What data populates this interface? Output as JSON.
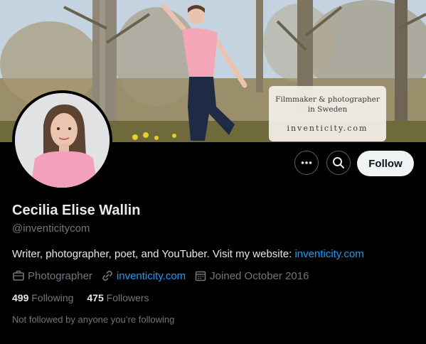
{
  "banner": {
    "card_line1": "Filmmaker & photographer",
    "card_line2": "in Sweden",
    "card_line3": "inventicity.com"
  },
  "actions": {
    "more_icon": "more-dots-icon",
    "search_icon": "search-icon",
    "follow_label": "Follow"
  },
  "profile": {
    "name": "Cecilia Elise Wallin",
    "handle": "@inventicitycom",
    "bio_text": "Writer, photographer, poet, and YouTuber. Visit my website: ",
    "bio_link": "inventicity.com"
  },
  "meta": {
    "category": "Photographer",
    "category_icon": "briefcase-icon",
    "website": "inventicity.com",
    "website_icon": "link-icon",
    "joined": "Joined October 2016",
    "joined_icon": "calendar-icon"
  },
  "stats": {
    "following_count": "499",
    "following_label": "Following",
    "followers_count": "475",
    "followers_label": "Followers"
  },
  "not_followed": "Not followed by anyone you’re following",
  "colors": {
    "background": "#000000",
    "accent_link": "#1d9bf0",
    "muted_text": "#71767b",
    "follow_bg": "#eff3f4"
  }
}
